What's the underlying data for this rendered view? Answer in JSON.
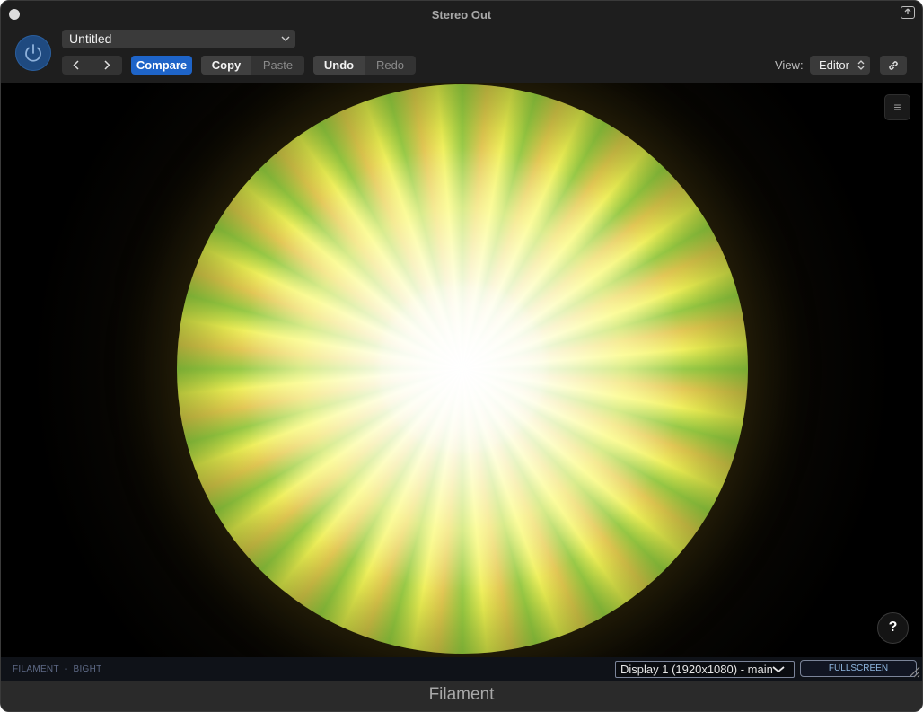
{
  "window": {
    "title": "Stereo Out"
  },
  "toolbar": {
    "preset": "Untitled",
    "compare_label": "Compare",
    "copy_label": "Copy",
    "paste_label": "Paste",
    "undo_label": "Undo",
    "redo_label": "Redo",
    "view_label": "View:",
    "view_value": "Editor"
  },
  "visualizer": {
    "menu_icon": "≡",
    "help_label": "?"
  },
  "statusbar": {
    "brand": "FILAMENT",
    "separator": "-",
    "company": "BIGHT",
    "display_option": "Display 1 (1920x1080) - main",
    "fullscreen_label": "FULLSCREEN"
  },
  "footer": {
    "plugin_name": "Filament"
  },
  "colors": {
    "accent": "#1e64c8",
    "power": "#1f4a80",
    "status_text": "#5e6a86",
    "fullscreen_text": "#8fb7e0"
  },
  "icons": [
    "power-icon",
    "chevron-left-icon",
    "chevron-right-icon",
    "chevron-down-icon",
    "updown-chevron-icon",
    "link-icon",
    "menu-icon",
    "help-icon",
    "detach-icon",
    "resize-grip-icon"
  ]
}
